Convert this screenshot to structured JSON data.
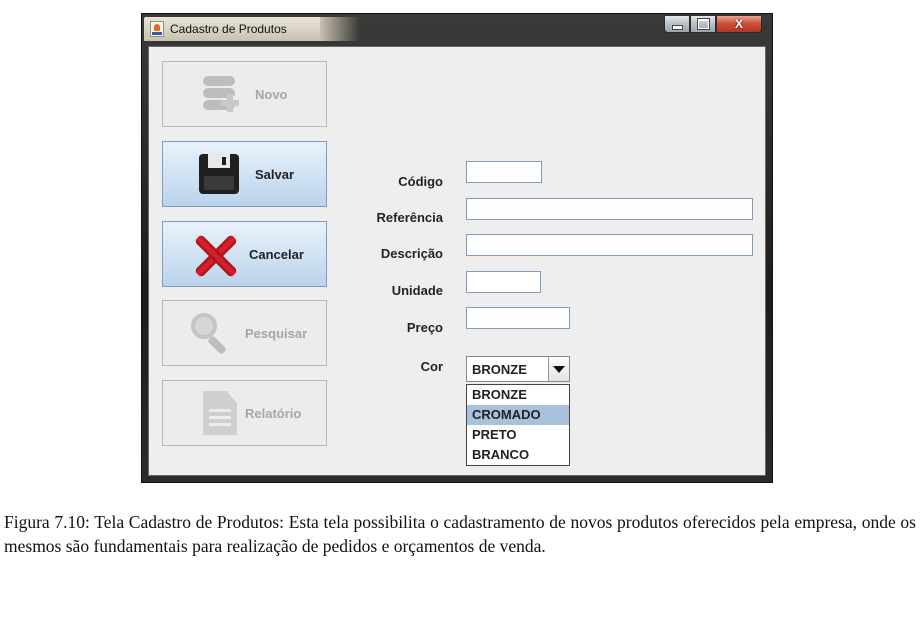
{
  "window": {
    "title": "Cadastro de Produtos",
    "controls": {
      "minimize": "minimize",
      "maximize": "maximize",
      "close": "X"
    }
  },
  "side_buttons": [
    {
      "label": "Novo",
      "icon": "database-add-icon",
      "enabled": false
    },
    {
      "label": "Salvar",
      "icon": "floppy-disk-icon",
      "enabled": true
    },
    {
      "label": "Cancelar",
      "icon": "red-x-icon",
      "enabled": true
    },
    {
      "label": "Pesquisar",
      "icon": "magnifier-icon",
      "enabled": false
    },
    {
      "label": "Relatório",
      "icon": "document-icon",
      "enabled": false
    }
  ],
  "form": {
    "codigo_label": "Código",
    "codigo_value": "",
    "referencia_label": "Referência",
    "referencia_value": "",
    "descricao_label": "Descrição",
    "descricao_value": "",
    "unidade_label": "Unidade",
    "unidade_value": "",
    "preco_label": "Preço",
    "preco_value": "",
    "cor_label": "Cor",
    "cor_selected": "BRONZE",
    "cor_options": [
      "BRONZE",
      "CROMADO",
      "PRETO",
      "BRANCO"
    ],
    "cor_highlighted": "CROMADO"
  },
  "colors": {
    "active_button": "#cfe1f3",
    "dropdown_highlight": "#a7c2da",
    "close_button": "#d0523d"
  },
  "caption": "Figura 7.10: Tela Cadastro de Produtos: Esta tela possibilita o cadastramento de novos produtos oferecidos pela empresa, onde os mesmos são fundamentais para realização de pedidos e orçamentos de venda."
}
